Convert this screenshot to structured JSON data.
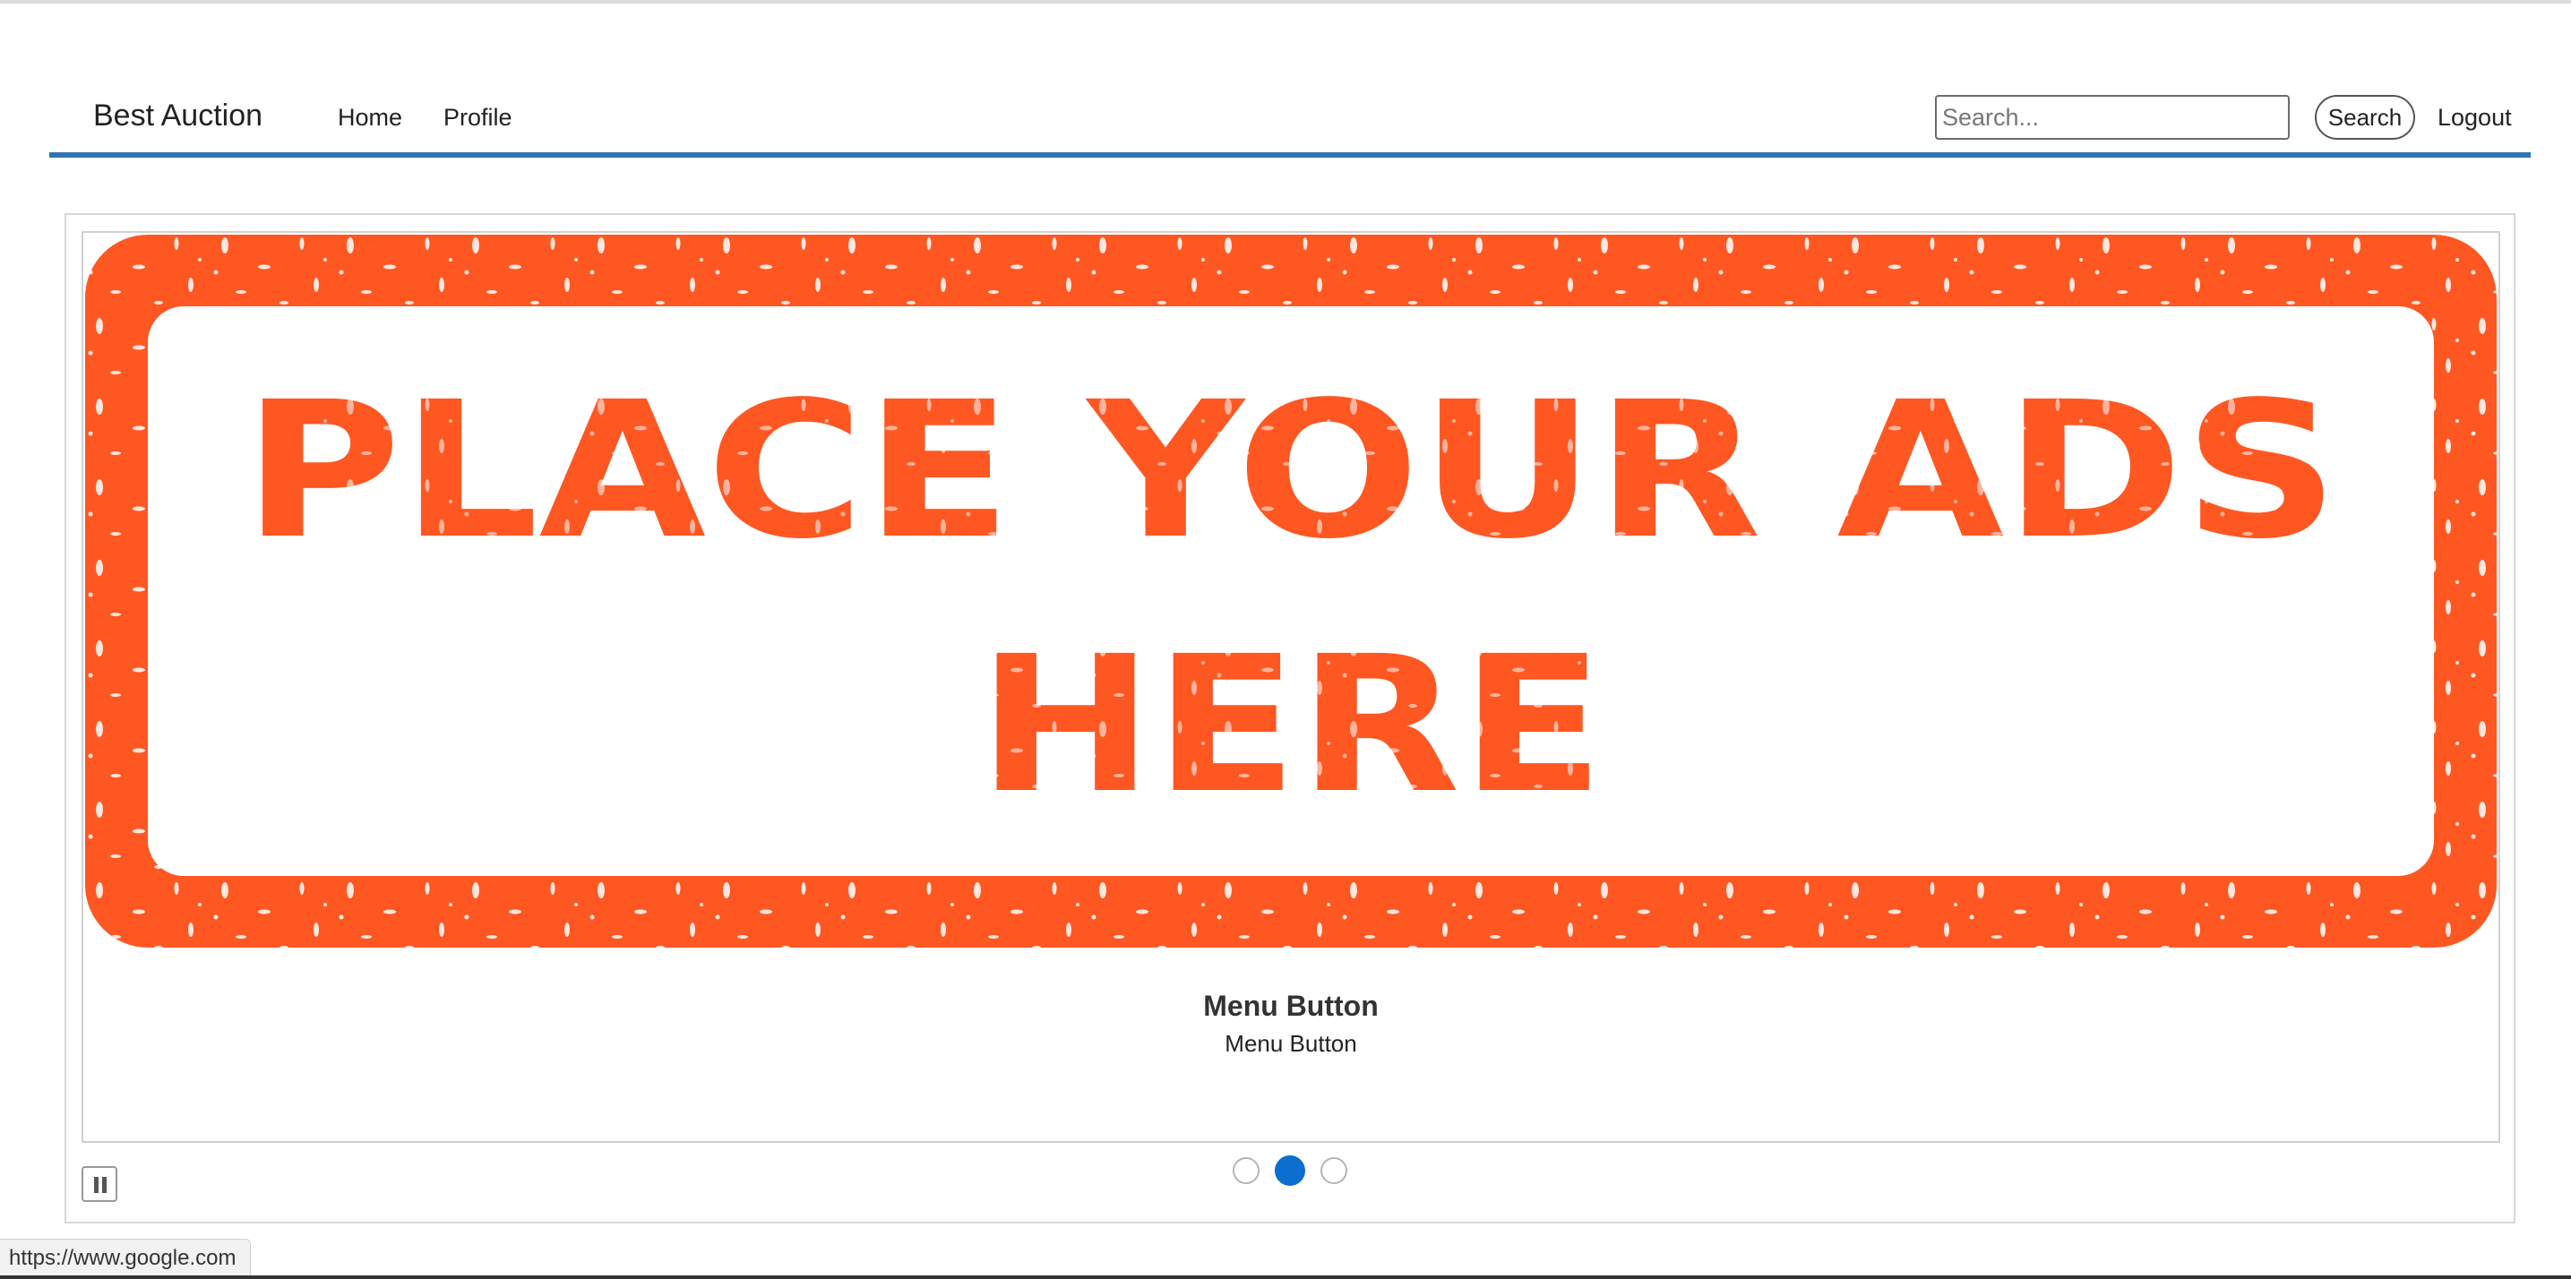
{
  "header": {
    "brand": "Best Auction",
    "nav": {
      "home": "Home",
      "profile": "Profile"
    },
    "search": {
      "placeholder": "Search...",
      "value": "",
      "button_label": "Search"
    },
    "logout": "Logout",
    "accent_color": "#2e75b0"
  },
  "carousel": {
    "ad": {
      "line1": "PLACE YOUR ADS",
      "line2": "HERE",
      "color": "#ff5722"
    },
    "caption": {
      "title": "Menu Button",
      "text": "Menu Button"
    },
    "indicators": {
      "count": 3,
      "active_index": 1,
      "active_color": "#0c6fcf"
    },
    "pause_icon": "pause-icon"
  },
  "status_bar": {
    "url": "https://www.google.com"
  }
}
